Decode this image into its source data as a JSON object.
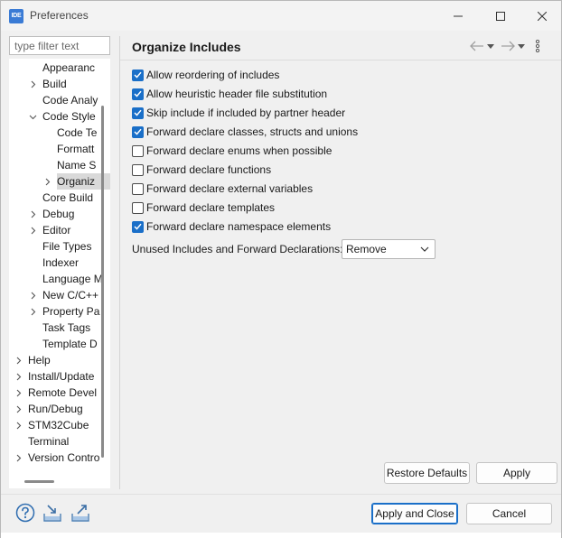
{
  "window": {
    "app_icon": "IDE",
    "title": "Preferences",
    "controls": [
      "minimize-icon",
      "maximize-icon",
      "close-icon"
    ]
  },
  "filter": {
    "placeholder": "type filter text",
    "value": ""
  },
  "tree": {
    "items": [
      {
        "label": "Appearanc",
        "indent": 2,
        "arrow": "none"
      },
      {
        "label": "Build",
        "indent": 2,
        "arrow": "collapsed"
      },
      {
        "label": "Code Analy",
        "indent": 2,
        "arrow": "none"
      },
      {
        "label": "Code Style",
        "indent": 2,
        "arrow": "expanded"
      },
      {
        "label": "Code Te",
        "indent": 3,
        "arrow": "none"
      },
      {
        "label": "Formatt",
        "indent": 3,
        "arrow": "none"
      },
      {
        "label": "Name S",
        "indent": 3,
        "arrow": "none"
      },
      {
        "label": "Organiz",
        "indent": 3,
        "arrow": "collapsed",
        "selected": true
      },
      {
        "label": "Core Build",
        "indent": 2,
        "arrow": "none"
      },
      {
        "label": "Debug",
        "indent": 2,
        "arrow": "collapsed"
      },
      {
        "label": "Editor",
        "indent": 2,
        "arrow": "collapsed"
      },
      {
        "label": "File Types",
        "indent": 2,
        "arrow": "none"
      },
      {
        "label": "Indexer",
        "indent": 2,
        "arrow": "none"
      },
      {
        "label": "Language M",
        "indent": 2,
        "arrow": "none"
      },
      {
        "label": "New C/C++",
        "indent": 2,
        "arrow": "collapsed"
      },
      {
        "label": "Property Pa",
        "indent": 2,
        "arrow": "collapsed"
      },
      {
        "label": "Task Tags",
        "indent": 2,
        "arrow": "none"
      },
      {
        "label": "Template D",
        "indent": 2,
        "arrow": "none"
      },
      {
        "label": "Help",
        "indent": 1,
        "arrow": "collapsed"
      },
      {
        "label": "Install/Update",
        "indent": 1,
        "arrow": "collapsed"
      },
      {
        "label": "Remote Devel",
        "indent": 1,
        "arrow": "collapsed"
      },
      {
        "label": "Run/Debug",
        "indent": 1,
        "arrow": "collapsed"
      },
      {
        "label": "STM32Cube",
        "indent": 1,
        "arrow": "collapsed"
      },
      {
        "label": "Terminal",
        "indent": 1,
        "arrow": "none"
      },
      {
        "label": "Version Contro",
        "indent": 1,
        "arrow": "collapsed"
      }
    ]
  },
  "page": {
    "title": "Organize Includes",
    "nav_icons": [
      "back-arrow-icon",
      "back-menu-caret-icon",
      "forward-arrow-icon",
      "forward-menu-caret-icon",
      "view-menu-icon"
    ],
    "options": [
      {
        "label": "Allow reordering of includes",
        "checked": true
      },
      {
        "label": "Allow heuristic header file substitution",
        "checked": true
      },
      {
        "label": "Skip include if included by partner header",
        "checked": true
      },
      {
        "label": "Forward declare classes, structs and unions",
        "checked": true
      },
      {
        "label": "Forward declare enums when possible",
        "checked": false
      },
      {
        "label": "Forward declare functions",
        "checked": false
      },
      {
        "label": "Forward declare external variables",
        "checked": false
      },
      {
        "label": "Forward declare templates",
        "checked": false
      },
      {
        "label": "Forward declare namespace elements",
        "checked": true
      }
    ],
    "unused": {
      "label": "Unused Includes and Forward Declarations:",
      "value": "Remove"
    },
    "restore_defaults": "Restore Defaults",
    "apply": "Apply"
  },
  "footer": {
    "icons": [
      "help-icon",
      "import-icon",
      "export-icon"
    ],
    "apply_and_close": "Apply and Close",
    "cancel": "Cancel"
  },
  "colors": {
    "accent": "#1a6fc8",
    "selection": "#d9d9d9",
    "window_bg": "#f0f0f0"
  }
}
